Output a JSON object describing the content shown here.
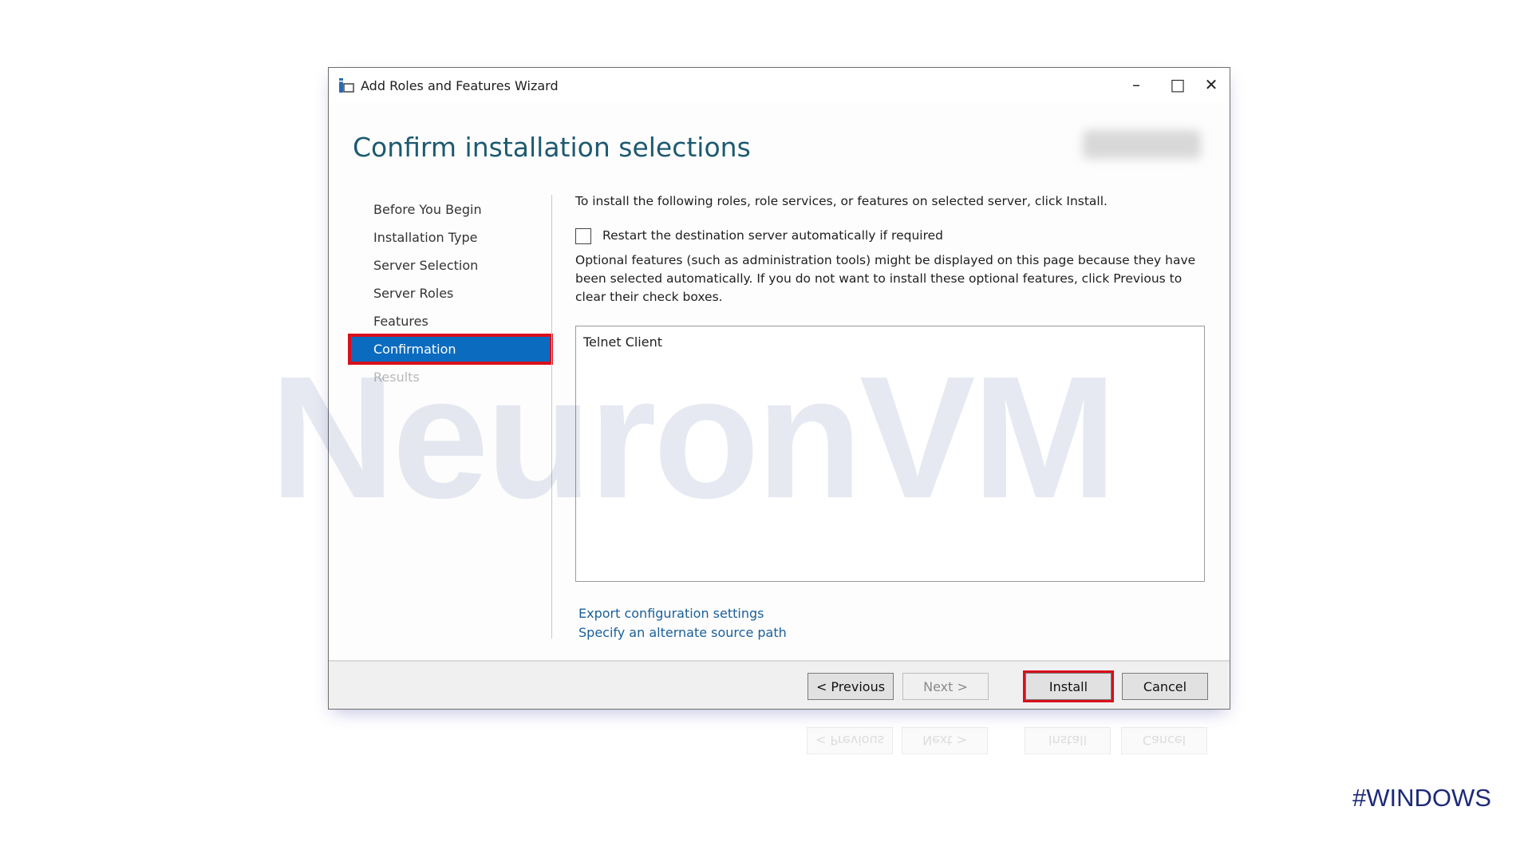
{
  "watermark": "NeuronVM",
  "window": {
    "title": "Add Roles and Features Wizard",
    "icon": "server-manager-icon"
  },
  "page_title": "Confirm installation selections",
  "nav": {
    "items": [
      {
        "label": "Before You Begin",
        "state": "normal"
      },
      {
        "label": "Installation Type",
        "state": "normal"
      },
      {
        "label": "Server Selection",
        "state": "normal"
      },
      {
        "label": "Server Roles",
        "state": "normal"
      },
      {
        "label": "Features",
        "state": "normal"
      },
      {
        "label": "Confirmation",
        "state": "active"
      },
      {
        "label": "Results",
        "state": "disabled"
      }
    ]
  },
  "content": {
    "intro": "To install the following roles, role services, or features on selected server, click Install.",
    "restart_checkbox": {
      "label": "Restart the destination server automatically if required",
      "checked": false
    },
    "optional_note": "Optional features (such as administration tools) might be displayed on this page because they have been selected automatically. If you do not want to install these optional features, click Previous to clear their check boxes.",
    "selections": [
      "Telnet Client"
    ],
    "links": [
      "Export configuration settings",
      "Specify an alternate source path"
    ]
  },
  "buttons": {
    "previous": "< Previous",
    "next": "Next >",
    "install": "Install",
    "cancel": "Cancel"
  },
  "colors": {
    "accent": "#0b6bbf",
    "highlight": "#d8101c",
    "heading": "#1d5a70",
    "tag": "#1e2a78"
  },
  "tag": "#WINDOWS"
}
